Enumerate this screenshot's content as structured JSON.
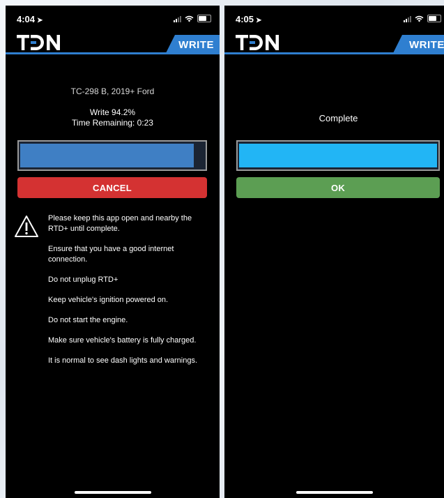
{
  "left_screen": {
    "status_time": "4:04",
    "header_tab": "WRITE",
    "device_name": "TC-298 B, 2019+ Ford",
    "write_progress_label": "Write 94.2%",
    "time_remaining": "Time Remaining: 0:23",
    "progress_fraction": 0.942,
    "cancel_label": "CANCEL",
    "instructions": [
      "Please keep this app open and nearby the RTD+ until complete.",
      "Ensure that you have a good internet connection.",
      "Do not unplug RTD+",
      "Keep vehicle's ignition powered on.",
      "Do not start the engine.",
      "Make sure vehicle's battery is fully charged.",
      "It is normal to see dash lights and warnings."
    ]
  },
  "right_screen": {
    "status_time": "4:05",
    "header_tab": "WRITE",
    "status_message": "Complete",
    "progress_fraction": 1.0,
    "ok_label": "OK"
  },
  "colors": {
    "accent_blue": "#2f7fd0",
    "progress_blue": "#3f7fc4",
    "progress_complete": "#22b5f5",
    "cancel_red": "#d43232",
    "ok_green": "#5c9e53"
  },
  "icons": {
    "location": "location-arrow-icon",
    "signal": "cellular-signal-icon",
    "wifi": "wifi-icon",
    "battery": "battery-icon",
    "warning": "warning-triangle-icon"
  }
}
